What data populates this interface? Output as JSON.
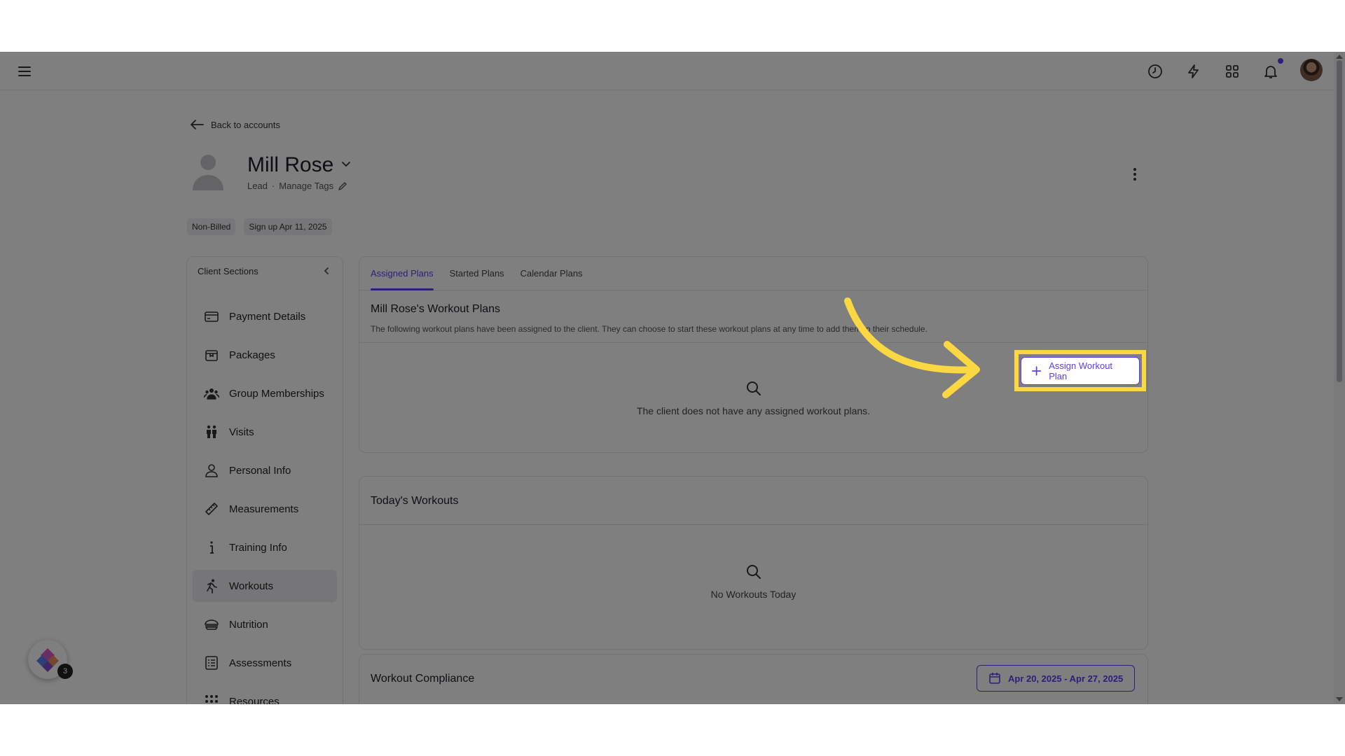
{
  "back_link": "Back to accounts",
  "profile": {
    "name": "Mill Rose",
    "status": "Lead",
    "separator": "·",
    "manage_tags": "Manage Tags"
  },
  "chips": [
    "Non-Billed",
    "Sign up Apr 11, 2025"
  ],
  "sidebar": {
    "title": "Client Sections",
    "items": [
      {
        "label": "Payment Details",
        "icon": "credit-card-icon"
      },
      {
        "label": "Packages",
        "icon": "package-icon"
      },
      {
        "label": "Group Memberships",
        "icon": "group-icon"
      },
      {
        "label": "Visits",
        "icon": "visits-icon"
      },
      {
        "label": "Personal Info",
        "icon": "person-icon"
      },
      {
        "label": "Measurements",
        "icon": "ruler-icon"
      },
      {
        "label": "Training Info",
        "icon": "info-icon"
      },
      {
        "label": "Workouts",
        "icon": "running-icon"
      },
      {
        "label": "Nutrition",
        "icon": "nutrition-icon"
      },
      {
        "label": "Assessments",
        "icon": "checklist-icon"
      },
      {
        "label": "Resources",
        "icon": "grid-icon"
      }
    ],
    "active_item": "Workouts"
  },
  "plans": {
    "tabs": [
      "Assigned Plans",
      "Started Plans",
      "Calendar Plans"
    ],
    "active_tab": "Assigned Plans",
    "title": "Mill Rose's Workout Plans",
    "description": "The following workout plans have been assigned to the client. They can choose to start these workout plans at any time to add them to their schedule.",
    "assign_button": "Assign Workout Plan",
    "empty": "The client does not have any assigned workout plans."
  },
  "today": {
    "title": "Today's Workouts",
    "empty": "No Workouts Today"
  },
  "compliance": {
    "title": "Workout Compliance",
    "date_range": "Apr 20, 2025 - Apr 27, 2025"
  },
  "fab_badge": "3",
  "colors": {
    "accent": "#5b3df5",
    "highlight": "#fbd742"
  }
}
